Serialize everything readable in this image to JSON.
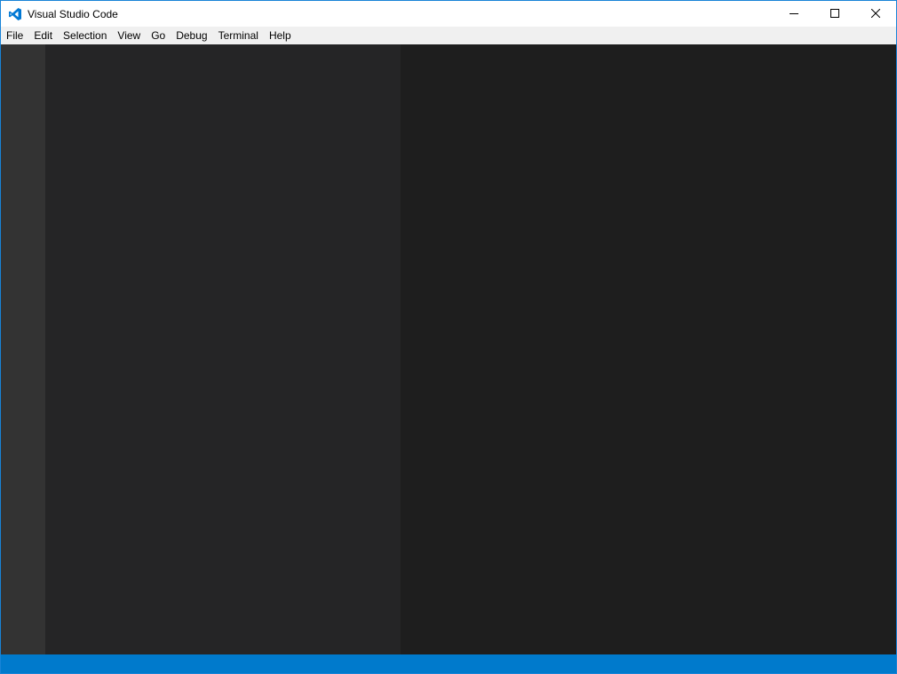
{
  "window": {
    "title": "Visual Studio Code",
    "border_color": "#1883d7"
  },
  "title_bar": {
    "app_icon": "vscode-logo-icon",
    "controls": [
      {
        "name": "minimize-icon",
        "glyph": "minimize"
      },
      {
        "name": "maximize-icon",
        "glyph": "maximize"
      },
      {
        "name": "close-icon",
        "glyph": "close"
      }
    ]
  },
  "menu": {
    "items": [
      "File",
      "Edit",
      "Selection",
      "View",
      "Go",
      "Debug",
      "Terminal",
      "Help"
    ]
  },
  "workbench": {
    "activity_bar_color": "#333333",
    "sidebar_color": "#252526",
    "editor_color": "#1e1e1e",
    "status_bar_color": "#007acc"
  }
}
